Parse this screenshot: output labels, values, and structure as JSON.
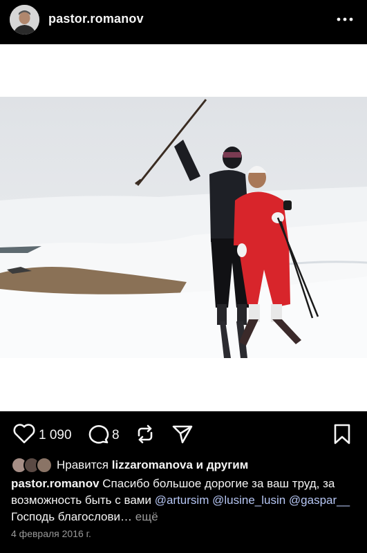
{
  "post": {
    "username": "pastor.romanov",
    "menu_icon": "more-horizontal-icon"
  },
  "actions": {
    "likes_count": "1 090",
    "comments_count": "8",
    "icons": [
      "heart-icon",
      "comment-icon",
      "repost-icon",
      "share-icon",
      "bookmark-icon"
    ]
  },
  "likes": {
    "prefix": "Нравится",
    "user": "lizzaromanova",
    "suffix": "и другим"
  },
  "caption": {
    "author": "pastor.romanov",
    "text": "Спасибо большое дорогие за ваш труд, за возможность быть с вами",
    "mention1": "@artursim",
    "mention2": "@lusine_lusin",
    "mention3": "@gaspar__",
    "tail": "Господь благослови…",
    "more": "ещё"
  },
  "date": "4 февраля 2016 г.",
  "colors": {
    "background": "#000000",
    "text": "#f5f5f5",
    "muted": "#9a9a9a",
    "mention": "#b6c6f4"
  }
}
